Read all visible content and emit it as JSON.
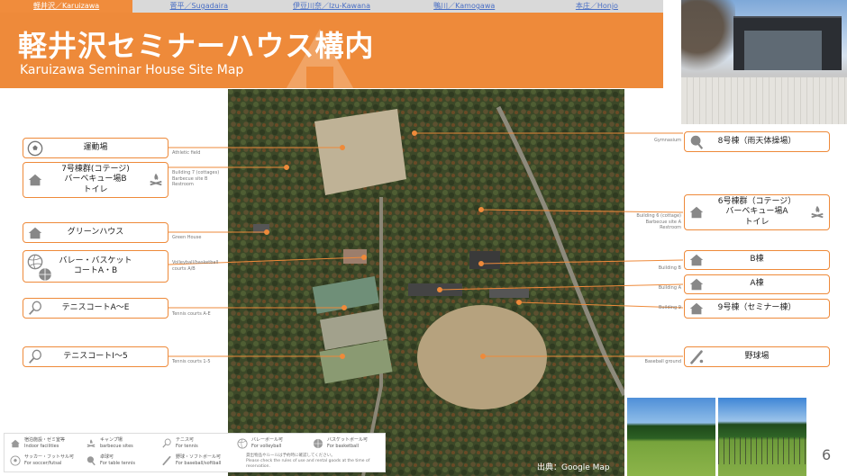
{
  "tabs": [
    {
      "label": "軽井沢／Karuizawa",
      "active": true
    },
    {
      "label": "菅平／Sugadaira",
      "active": false
    },
    {
      "label": "伊豆川奈／Izu-Kawana",
      "active": false
    },
    {
      "label": "鴨川／Kamogawa",
      "active": false
    },
    {
      "label": "本庄／Honjo",
      "active": false
    }
  ],
  "header": {
    "title": "軽井沢セミナーハウス構内",
    "subtitle": "Karuizawa Seminar House Site Map"
  },
  "labels": {
    "athletic": {
      "ja": "運動場",
      "en": "Athletic field",
      "icon": "soccer-ball-icon"
    },
    "building7": {
      "ja": "7号棟群(コテージ)\nバーベキュー場B\nトイレ",
      "en": "Building 7 (cottages)\nBarbecue site B\nRestroom",
      "icon": "house-icon",
      "icon2": "campfire-icon"
    },
    "greenhouse": {
      "ja": "グリーンハウス",
      "en": "Green House",
      "icon": "house-icon"
    },
    "volley": {
      "ja": "バレー・バスケット\nコートA・B",
      "en": "Volleyball/basketball\ncourts A/B",
      "icon": "volleyball-icon",
      "icon2": "basketball-icon"
    },
    "tennisAE": {
      "ja": "テニスコートA～E",
      "en": "Tennis courts A-E",
      "icon": "tennis-racket-icon"
    },
    "tennis15": {
      "ja": "テニスコートⅠ～5",
      "en": "Tennis courts 1-5",
      "icon": "tennis-racket-icon"
    },
    "building8": {
      "ja": "8号棟（雨天体操場）",
      "en": "Gymnasium",
      "icon": "table-tennis-icon"
    },
    "building6": {
      "ja": "6号棟群（コテージ）\nバーベキュー場A\nトイレ",
      "en": "Building 6 (cottage)\nBarbecue site A\nRestroom",
      "icon": "house-icon",
      "icon2": "campfire-icon"
    },
    "buildingB": {
      "ja": "B棟",
      "en": "Building B",
      "icon": "house-icon"
    },
    "buildingA": {
      "ja": "A棟",
      "en": "Building A",
      "icon": "house-icon"
    },
    "building9": {
      "ja": "9号棟（セミナー棟）",
      "en": "Building 9",
      "icon": "house-icon"
    },
    "baseball": {
      "ja": "野球場",
      "en": "Baseball ground",
      "icon": "baseball-bat-icon"
    }
  },
  "legend": {
    "items": [
      {
        "ja": "宿泊施設・ゼミ室等",
        "en": "Indoor facilities",
        "icon": "house-icon"
      },
      {
        "ja": "キャンプ場",
        "en": "barbecue sites",
        "icon": "campfire-icon"
      },
      {
        "ja": "テニス可",
        "en": "For tennis",
        "icon": "tennis-racket-icon"
      },
      {
        "ja": "バレーボール可",
        "en": "For volleyball",
        "icon": "volleyball-icon"
      },
      {
        "ja": "バスケットボール可",
        "en": "For basketball",
        "icon": "basketball-icon"
      },
      {
        "ja": "サッカー・フットサル可",
        "en": "For soccer/futsal",
        "icon": "soccer-ball-icon"
      },
      {
        "ja": "卓球可",
        "en": "For table tennis",
        "icon": "table-tennis-icon"
      },
      {
        "ja": "野球・ソフトボール可",
        "en": "For baseball/softball",
        "icon": "baseball-bat-icon"
      }
    ],
    "note": "貸出物品やルールは予約時に確認してください。\nPlease check the rules of use and rental goods at the time of reservation."
  },
  "map_credit": "出典：Google Map",
  "page_number": "6",
  "colors": {
    "accent": "#ee8a3a",
    "link": "#4a6fc4"
  }
}
